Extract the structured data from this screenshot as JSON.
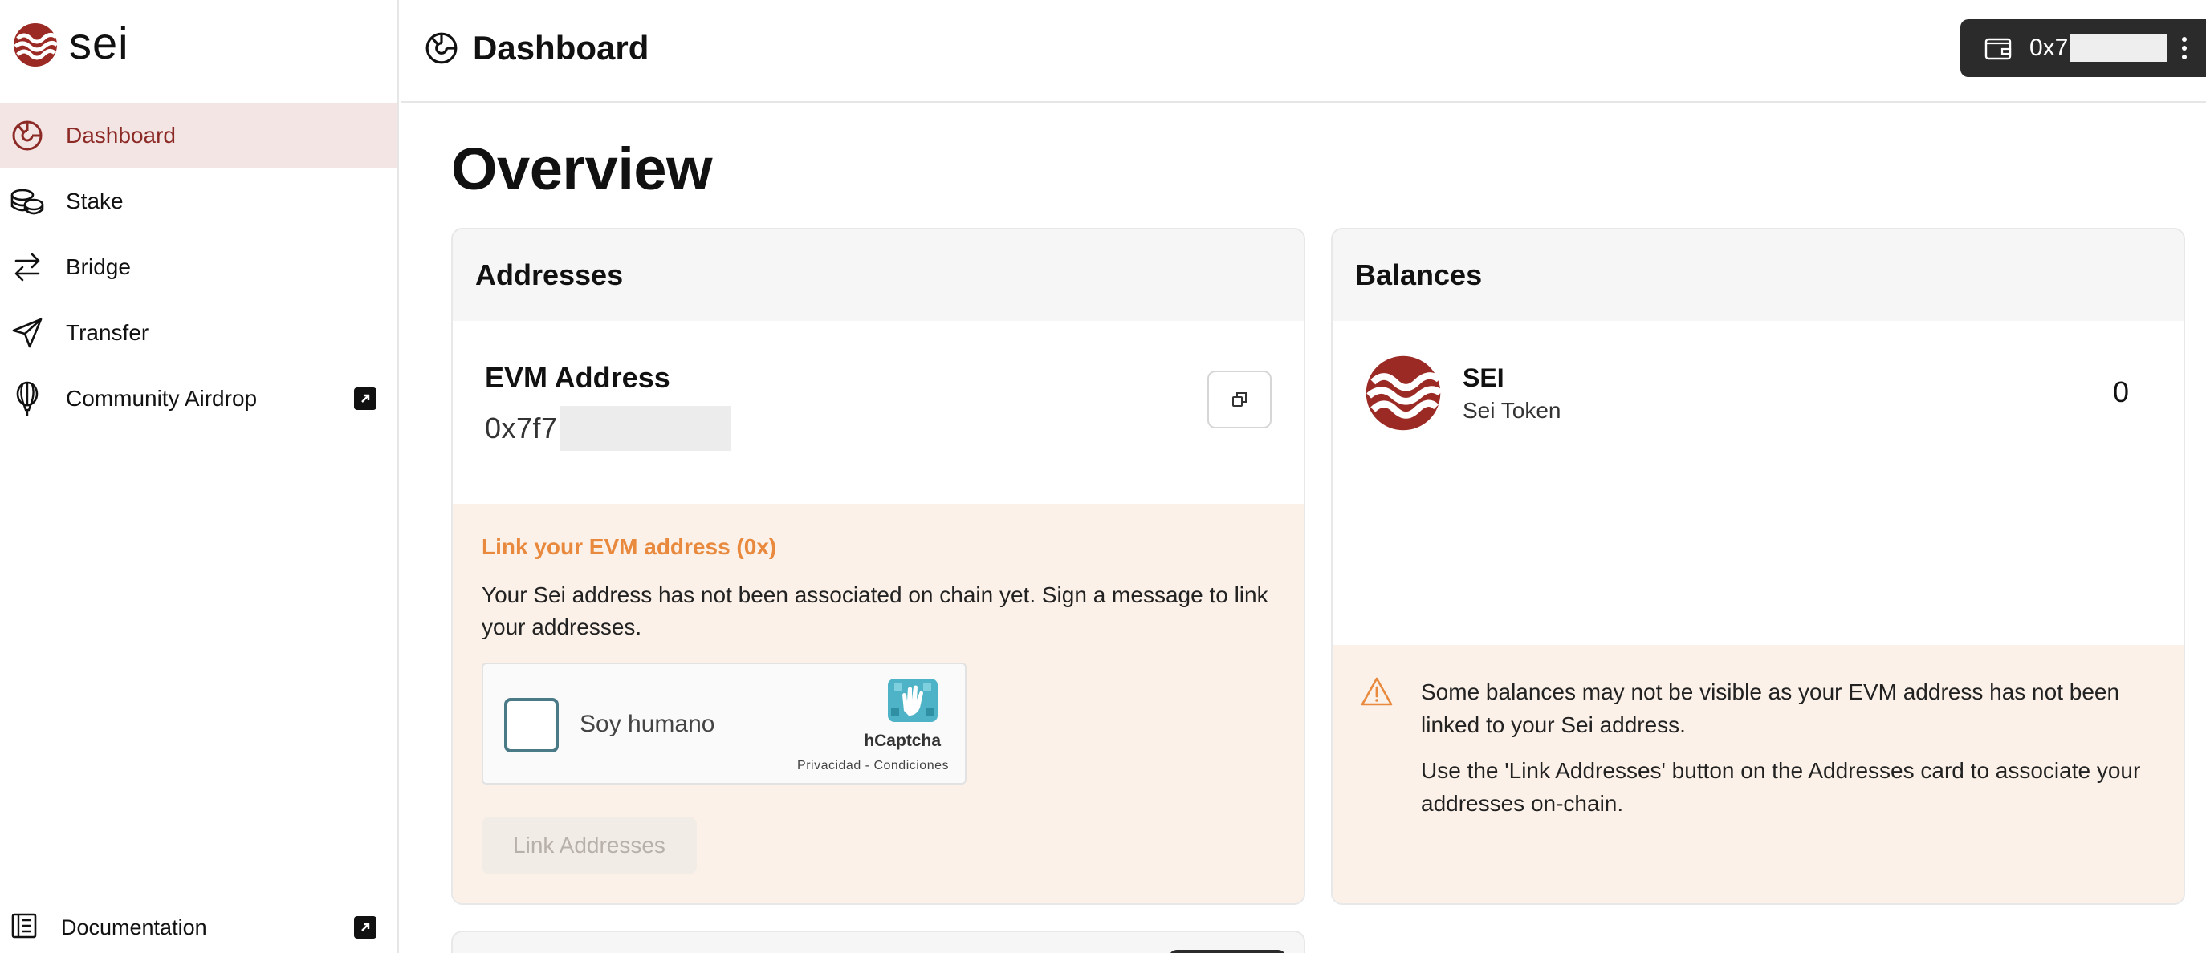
{
  "app": {
    "logo_text": "sei"
  },
  "sidebar": {
    "items": [
      {
        "label": "Dashboard",
        "icon": "dashboard-icon",
        "active": true
      },
      {
        "label": "Stake",
        "icon": "coins-icon"
      },
      {
        "label": "Bridge",
        "icon": "arrows-swap-icon"
      },
      {
        "label": "Transfer",
        "icon": "send-icon"
      },
      {
        "label": "Community Airdrop",
        "icon": "balloon-icon",
        "external": true
      }
    ],
    "documentation": {
      "label": "Documentation",
      "icon": "document-icon",
      "external": true
    }
  },
  "header": {
    "title": "Dashboard",
    "wallet": {
      "address": "0x7",
      "icon": "wallet-icon"
    }
  },
  "main": {
    "heading": "Overview",
    "addresses": {
      "title": "Addresses",
      "evm_label": "EVM Address",
      "evm_value": "0x7f7",
      "link_title": "Link your EVM address (0x)",
      "link_desc": "Your Sei address has not been associated on chain yet. Sign a message to link your addresses.",
      "captcha": {
        "label": "Soy humano",
        "brand": "hCaptcha",
        "links": "Privacidad - Condiciones"
      },
      "link_button": "Link Addresses"
    },
    "balances": {
      "title": "Balances",
      "token": {
        "symbol": "SEI",
        "name": "Sei Token",
        "balance": "0"
      },
      "warning": [
        "Some balances may not be visible as your EVM address has not been linked to your Sei address.",
        "Use the 'Link Addresses' button on the Addresses card to associate your addresses on-chain."
      ]
    }
  },
  "colors": {
    "brand": "#9b2a24",
    "active_bg": "#f3e5e4",
    "active_text": "#8c2a26",
    "warning_bg": "#fbf1e8",
    "warning_accent": "#e8893d",
    "wallet_bg": "#2b2b2b"
  }
}
